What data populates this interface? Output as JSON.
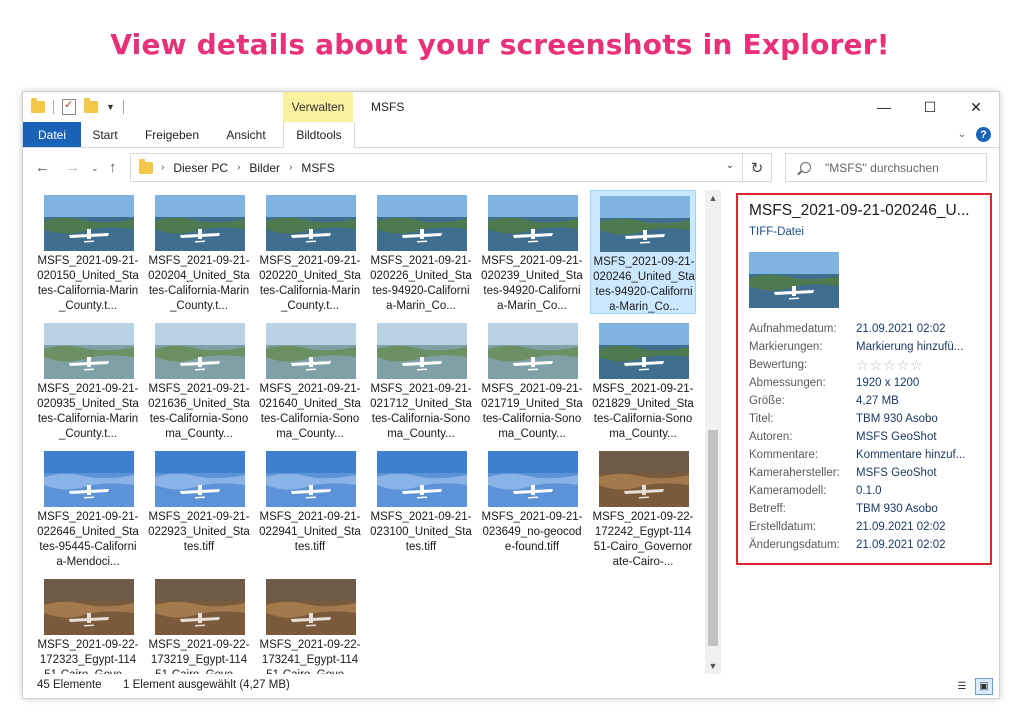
{
  "headline": "View details about your screenshots in Explorer!",
  "window": {
    "title": "MSFS",
    "context_tab_group": "Verwalten",
    "controls": [
      "—",
      "☐",
      "✕"
    ]
  },
  "ribbon": {
    "tabs": [
      "Datei",
      "Start",
      "Freigeben",
      "Ansicht",
      "Bildtools"
    ]
  },
  "address": {
    "crumbs": [
      "Dieser PC",
      "Bilder",
      "MSFS"
    ],
    "search_placeholder": "\"MSFS\" durchsuchen"
  },
  "files": [
    {
      "name": "MSFS_2021-09-21-020150_United_States-California-Marin_County.t...",
      "scene": "day"
    },
    {
      "name": "MSFS_2021-09-21-020204_United_States-California-Marin_County.t...",
      "scene": "day"
    },
    {
      "name": "MSFS_2021-09-21-020220_United_States-California-Marin_County.t...",
      "scene": "day"
    },
    {
      "name": "MSFS_2021-09-21-020226_United_States-94920-California-Marin_Co...",
      "scene": "day"
    },
    {
      "name": "MSFS_2021-09-21-020239_United_States-94920-California-Marin_Co...",
      "scene": "day"
    },
    {
      "name": "MSFS_2021-09-21-020246_United_States-94920-California-Marin_Co...",
      "scene": "day",
      "selected": true
    },
    {
      "name": "MSFS_2021-09-21-020935_United_States-California-Marin_County.t...",
      "scene": "haze"
    },
    {
      "name": "MSFS_2021-09-21-021636_United_States-California-Sonoma_County...",
      "scene": "haze"
    },
    {
      "name": "MSFS_2021-09-21-021640_United_States-California-Sonoma_County...",
      "scene": "haze"
    },
    {
      "name": "MSFS_2021-09-21-021712_United_States-California-Sonoma_County...",
      "scene": "haze"
    },
    {
      "name": "MSFS_2021-09-21-021719_United_States-California-Sonoma_County...",
      "scene": "haze"
    },
    {
      "name": "MSFS_2021-09-21-021829_United_States-California-Sonoma_County...",
      "scene": "day"
    },
    {
      "name": "MSFS_2021-09-21-022646_United_States-95445-California-Mendoci...",
      "scene": "sky"
    },
    {
      "name": "MSFS_2021-09-21-022923_United_States.tiff",
      "scene": "sky"
    },
    {
      "name": "MSFS_2021-09-21-022941_United_States.tiff",
      "scene": "sky"
    },
    {
      "name": "MSFS_2021-09-21-023100_United_States.tiff",
      "scene": "sky"
    },
    {
      "name": "MSFS_2021-09-21-023649_no-geocode-found.tiff",
      "scene": "sky"
    },
    {
      "name": "MSFS_2021-09-22-172242_Egypt-11451-Cairo_Governorate-Cairo-...",
      "scene": "desert"
    },
    {
      "name": "MSFS_2021-09-22-172323_Egypt-11451-Cairo_Gove...",
      "scene": "desert"
    },
    {
      "name": "MSFS_2021-09-22-173219_Egypt-11451-Cairo_Gove...",
      "scene": "desert"
    },
    {
      "name": "MSFS_2021-09-22-173241_Egypt-11451-Cairo_Gove...",
      "scene": "desert"
    }
  ],
  "details": {
    "title": "MSFS_2021-09-21-020246_U...",
    "type": "TIFF-Datei",
    "properties": [
      {
        "label": "Aufnahmedatum:",
        "value": "21.09.2021 02:02"
      },
      {
        "label": "Markierungen:",
        "value": "Markierung hinzufü..."
      },
      {
        "label": "Bewertung:",
        "value": "☆☆☆☆☆"
      },
      {
        "label": "Abmessungen:",
        "value": "1920 x 1200"
      },
      {
        "label": "Größe:",
        "value": "4,27 MB"
      },
      {
        "label": "Titel:",
        "value": "TBM 930 Asobo"
      },
      {
        "label": "Autoren:",
        "value": "MSFS GeoShot"
      },
      {
        "label": "Kommentare:",
        "value": "Kommentare hinzuf..."
      },
      {
        "label": "Kamerahersteller:",
        "value": "MSFS GeoShot"
      },
      {
        "label": "Kameramodell:",
        "value": "0.1.0"
      },
      {
        "label": "Betreff:",
        "value": "TBM 930 Asobo"
      },
      {
        "label": "Erstelldatum:",
        "value": "21.09.2021 02:02"
      },
      {
        "label": "Änderungsdatum:",
        "value": "21.09.2021 02:02"
      }
    ]
  },
  "status": {
    "count": "45 Elemente",
    "selection": "1 Element ausgewählt (4,27 MB)"
  },
  "colors": {
    "headline": "#e8317a",
    "accent": "#1a62b8",
    "selection": "#cce8ff",
    "highlight_border": "#e0262e",
    "context_tab": "#f9f0a0"
  }
}
